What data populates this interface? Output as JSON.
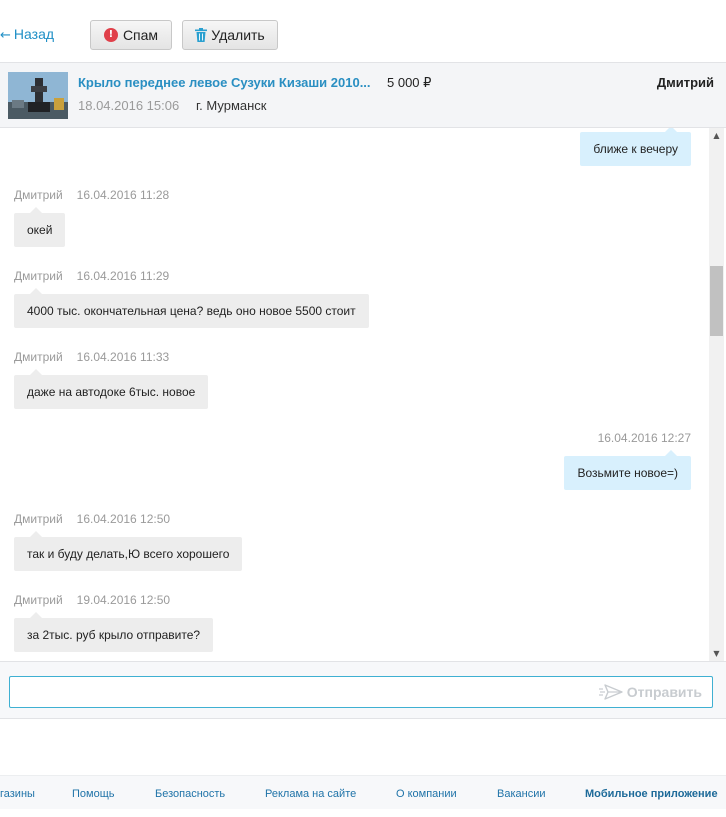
{
  "toolbar": {
    "back_label": "Назад",
    "spam_label": "Спам",
    "delete_label": "Удалить"
  },
  "item": {
    "title": "Крыло переднее левое Сузуки Кизаши 2010...",
    "price": "5 000 ₽",
    "date": "18.04.2016 15:06",
    "city": "г. Мурманск",
    "user": "Дмитрий"
  },
  "messages": [
    {
      "direction": "out",
      "author": "",
      "time": "",
      "text": "ближе к вечеру"
    },
    {
      "direction": "in",
      "author": "Дмитрий",
      "time": "16.04.2016 11:28",
      "text": "окей"
    },
    {
      "direction": "in",
      "author": "Дмитрий",
      "time": "16.04.2016 11:29",
      "text": "4000 тыс. окончательная цена? ведь оно новое 5500 стоит"
    },
    {
      "direction": "in",
      "author": "Дмитрий",
      "time": "16.04.2016 11:33",
      "text": "даже на автодоке 6тыс. новое"
    },
    {
      "direction": "out",
      "author": "",
      "time": "16.04.2016 12:27",
      "text": "Возьмите новое=)"
    },
    {
      "direction": "in",
      "author": "Дмитрий",
      "time": "16.04.2016 12:50",
      "text": "так и буду делать,Ю всего хорошего"
    },
    {
      "direction": "in",
      "author": "Дмитрий",
      "time": "19.04.2016 12:50",
      "text": "за 2тыс. руб крыло отправите?"
    }
  ],
  "composer": {
    "placeholder": "",
    "send_label": "Отправить"
  },
  "footer": {
    "links": [
      "газины",
      "Помощь",
      "Безопасность",
      "Реклама на сайте",
      "О компании",
      "Вакансии",
      "Мобильное приложение"
    ]
  },
  "colors": {
    "accent": "#1f8fc6",
    "incoming_bubble": "#ededed",
    "outgoing_bubble": "#d8f0fd",
    "input_border": "#3fb0d2",
    "spam_icon": "#e0404a"
  }
}
